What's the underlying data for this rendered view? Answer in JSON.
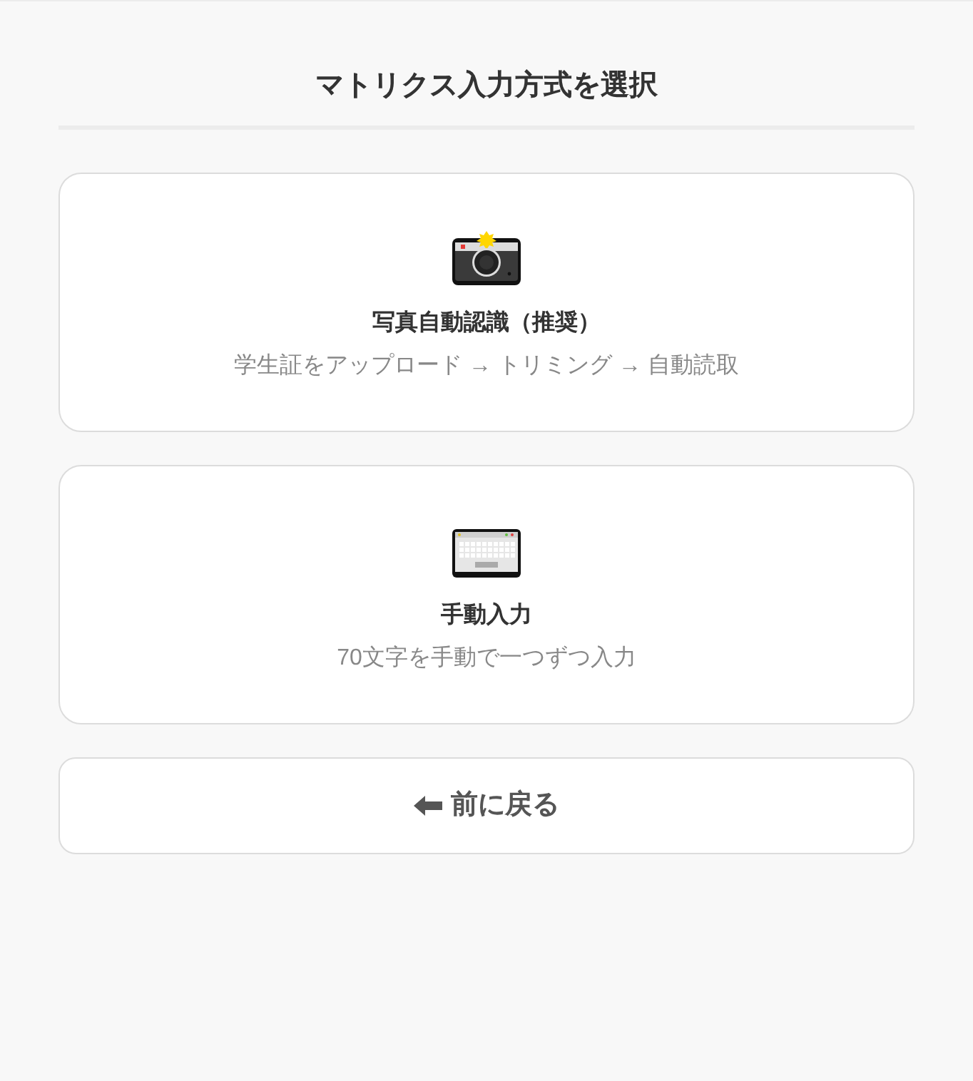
{
  "title": "マトリクス入力方式を選択",
  "options": [
    {
      "kind": "camera",
      "title": "写真自動認識（推奨）",
      "description": "学生証をアップロード → トリミング → 自動読取"
    },
    {
      "kind": "keyboard",
      "title": "手動入力",
      "description": "70文字を手動で一つずつ入力"
    }
  ],
  "back_button": {
    "label": "前に戻る"
  }
}
